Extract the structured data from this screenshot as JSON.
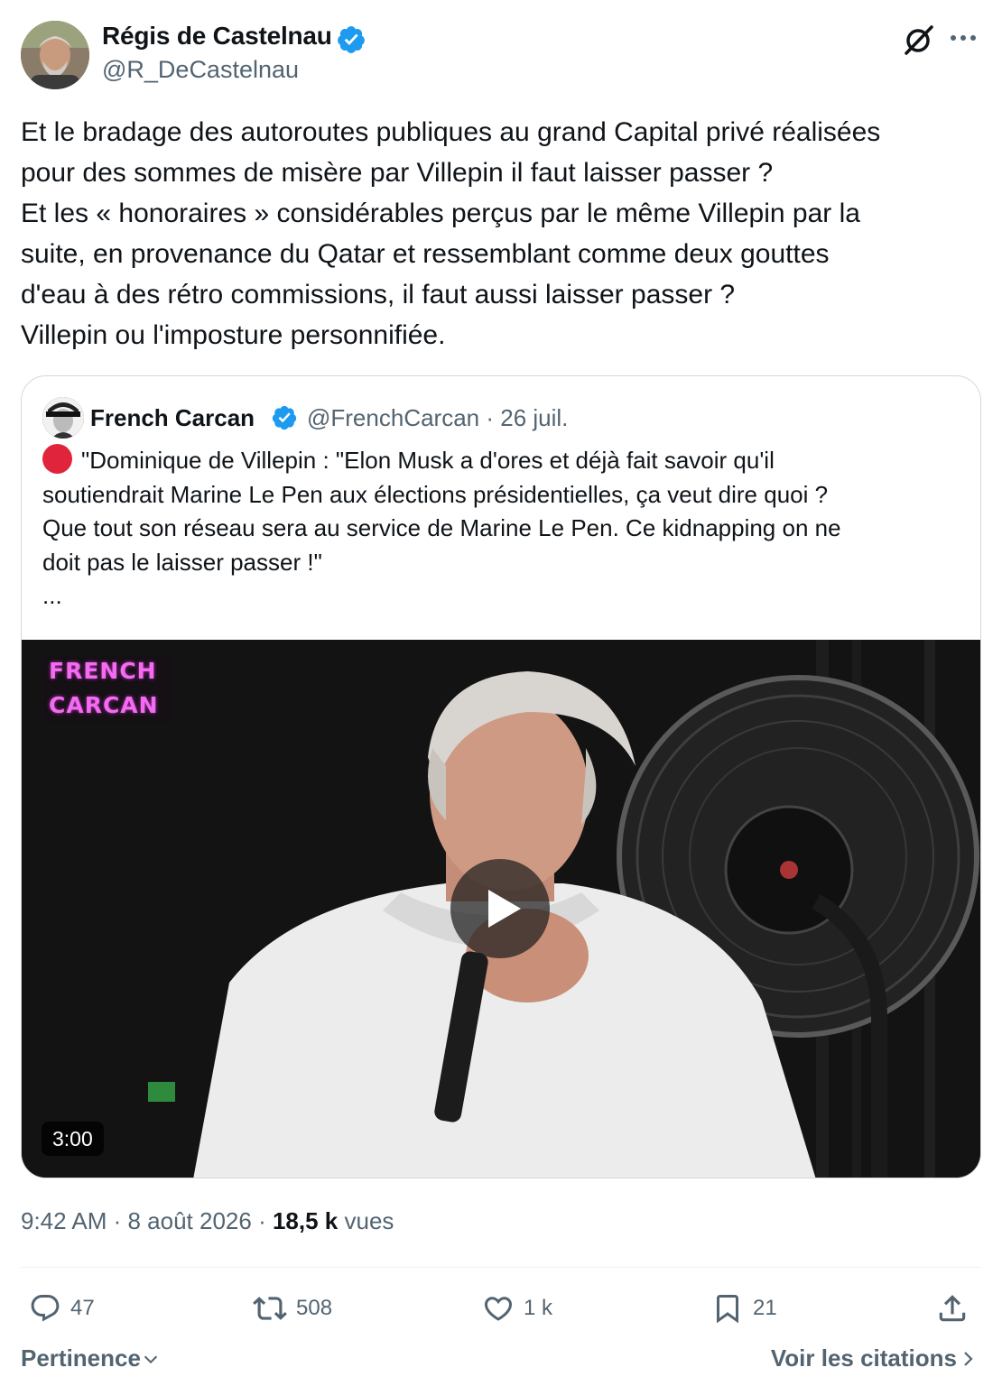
{
  "author": {
    "name": "Régis de Castelnau",
    "handle": "@R_DeCastelnau"
  },
  "tweet_lines": [
    "Et le bradage des autoroutes publiques au grand Capital privé réalisées",
    "pour des sommes de misère par Villepin il faut laisser passer ?",
    "Et les « honoraires » considérables perçus par le même Villepin par la",
    "suite, en provenance du Qatar et ressemblant comme deux gouttes",
    "d'eau à des rétro commissions, il faut aussi laisser passer ?",
    "Villepin ou l'imposture personnifiée."
  ],
  "quote": {
    "name": "French Carcan",
    "meta": "@FrenchCarcan · 26 juil.",
    "lines": [
      "\"Dominique de Villepin :  \"Elon Musk a d'ores et déjà fait savoir qu'il",
      "soutiendrait Marine Le Pen aux élections présidentielles, ça veut dire quoi ?",
      "Que tout son réseau sera au service de Marine Le Pen. Ce kidnapping on ne",
      "doit pas le laisser passer !\"",
      "..."
    ],
    "video": {
      "logo_line1": "FRENCH",
      "logo_line2": "CARCAN",
      "duration": "3:00"
    }
  },
  "post_meta": {
    "time_date": "9:42 AM · 8 août 2026 · ",
    "views_count": "18,5 k",
    "views_label": " vues"
  },
  "actions": {
    "replies": "47",
    "reposts": "508",
    "likes": "1 k",
    "bookmarks": "21"
  },
  "footer": {
    "sort_label": "Pertinence",
    "quotes_link": "Voir les citations"
  },
  "colors": {
    "verified": "#1d9bf0",
    "secondary_text": "#536471",
    "primary_text": "#0f1419",
    "logo_pink": "#f26bf0"
  },
  "icons": [
    "verified-badge-icon",
    "grok-icon",
    "more-icon",
    "play-icon",
    "reply-icon",
    "retweet-icon",
    "like-icon",
    "bookmark-icon",
    "share-icon",
    "chevron-down-icon",
    "chevron-right-icon"
  ]
}
